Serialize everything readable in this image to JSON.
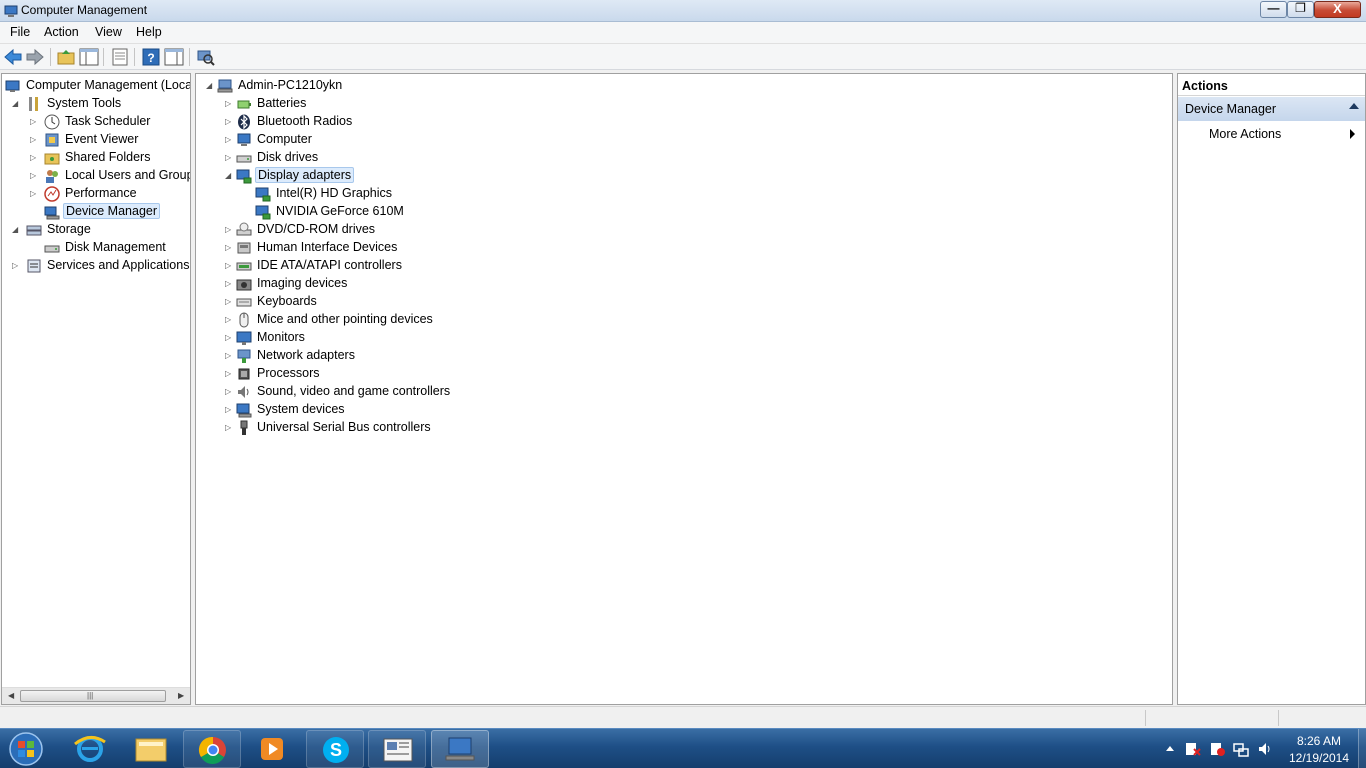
{
  "window": {
    "title": "Computer Management",
    "minimize_glyph": "—",
    "maximize_glyph": "❐",
    "close_glyph": "X"
  },
  "menu": [
    "File",
    "Action",
    "View",
    "Help"
  ],
  "toolbar_icons": [
    "back-arrow-icon",
    "forward-arrow-icon",
    "up-folder-icon",
    "show-hide-tree-icon",
    "properties-icon",
    "help-icon",
    "show-action-pane-icon",
    "scan-hardware-icon"
  ],
  "left_tree": [
    {
      "label": "Computer Management (Local",
      "icon": "computer-management-icon",
      "level": 0,
      "expander": ""
    },
    {
      "label": "System Tools",
      "icon": "system-tools-icon",
      "level": 1,
      "expander": "◢"
    },
    {
      "label": "Task Scheduler",
      "icon": "task-scheduler-icon",
      "level": 2,
      "expander": "▷"
    },
    {
      "label": "Event Viewer",
      "icon": "event-viewer-icon",
      "level": 2,
      "expander": "▷"
    },
    {
      "label": "Shared Folders",
      "icon": "shared-folders-icon",
      "level": 2,
      "expander": "▷"
    },
    {
      "label": "Local Users and Groups",
      "icon": "local-users-icon",
      "level": 2,
      "expander": "▷"
    },
    {
      "label": "Performance",
      "icon": "performance-icon",
      "level": 2,
      "expander": "▷"
    },
    {
      "label": "Device Manager",
      "icon": "device-manager-icon",
      "level": 2,
      "expander": "",
      "selected": true
    },
    {
      "label": "Storage",
      "icon": "storage-icon",
      "level": 1,
      "expander": "◢"
    },
    {
      "label": "Disk Management",
      "icon": "disk-management-icon",
      "level": 2,
      "expander": ""
    },
    {
      "label": "Services and Applications",
      "icon": "services-icon",
      "level": 1,
      "expander": "▷"
    }
  ],
  "left_scrollbar": {
    "left_arrow": "◀",
    "right_arrow": "▶",
    "grip": "|||"
  },
  "device_tree": {
    "root": "Admin-PC1210ykn",
    "categories": [
      {
        "label": "Batteries",
        "icon": "battery-icon"
      },
      {
        "label": "Bluetooth Radios",
        "icon": "bluetooth-icon"
      },
      {
        "label": "Computer",
        "icon": "computer-icon"
      },
      {
        "label": "Disk drives",
        "icon": "disk-drive-icon"
      },
      {
        "label": "Display adapters",
        "icon": "display-adapter-icon",
        "expanded": true,
        "children": [
          "Intel(R) HD Graphics",
          "NVIDIA GeForce 610M"
        ]
      },
      {
        "label": "DVD/CD-ROM drives",
        "icon": "dvd-drive-icon"
      },
      {
        "label": "Human Interface Devices",
        "icon": "hid-icon"
      },
      {
        "label": "IDE ATA/ATAPI controllers",
        "icon": "ide-controller-icon"
      },
      {
        "label": "Imaging devices",
        "icon": "camera-icon"
      },
      {
        "label": "Keyboards",
        "icon": "keyboard-icon"
      },
      {
        "label": "Mice and other pointing devices",
        "icon": "mouse-icon"
      },
      {
        "label": "Monitors",
        "icon": "monitor-icon"
      },
      {
        "label": "Network adapters",
        "icon": "network-adapter-icon"
      },
      {
        "label": "Processors",
        "icon": "processor-icon"
      },
      {
        "label": "Sound, video and game controllers",
        "icon": "sound-icon"
      },
      {
        "label": "System devices",
        "icon": "system-devices-icon"
      },
      {
        "label": "Universal Serial Bus controllers",
        "icon": "usb-icon"
      }
    ]
  },
  "actions": {
    "header": "Actions",
    "section": "Device Manager",
    "items": [
      "More Actions"
    ]
  },
  "taskbar": {
    "apps": [
      "internet-explorer-icon",
      "file-explorer-icon",
      "chrome-icon",
      "media-player-icon",
      "skype-icon",
      "news-app-icon",
      "computer-management-taskbar-icon"
    ],
    "time": "8:26 AM",
    "date": "12/19/2014",
    "tray_icons": [
      "show-hidden-icons-icon",
      "action-center-icon",
      "security-icon",
      "network-icon",
      "volume-icon"
    ]
  },
  "colors": {
    "selection": "#dcebfc",
    "taskbar": "#1e4f86",
    "actions_section": "#c5d6ec"
  }
}
